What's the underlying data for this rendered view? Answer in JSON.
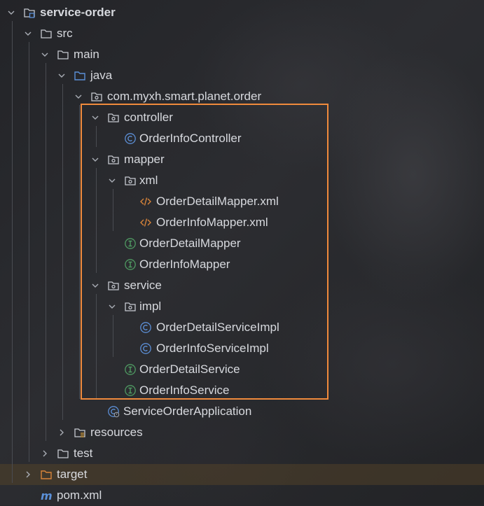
{
  "colors": {
    "background": "#26272b",
    "text": "#d7d9de",
    "highlight_border": "#f08a3c",
    "class_icon": "#5c8fd6",
    "interface_icon": "#4f9a62",
    "xml_icon": "#d8843a",
    "folder_source": "#5b90d8",
    "selected_row": "#5c4828"
  },
  "tree": {
    "root": {
      "label": "service-order",
      "icon": "module-folder-icon"
    },
    "src": {
      "label": "src",
      "icon": "folder-icon"
    },
    "main": {
      "label": "main",
      "icon": "folder-icon"
    },
    "java": {
      "label": "java",
      "icon": "source-folder-icon"
    },
    "package": {
      "label": "com.myxh.smart.planet.order",
      "icon": "package-icon"
    },
    "controller": {
      "label": "controller",
      "icon": "package-icon"
    },
    "order_info_controller": {
      "label": "OrderInfoController",
      "icon": "class-icon"
    },
    "mapper": {
      "label": "mapper",
      "icon": "package-icon"
    },
    "xml": {
      "label": "xml",
      "icon": "package-icon"
    },
    "order_detail_mapper_xml": {
      "label": "OrderDetailMapper.xml",
      "icon": "xml-icon"
    },
    "order_info_mapper_xml": {
      "label": "OrderInfoMapper.xml",
      "icon": "xml-icon"
    },
    "order_detail_mapper": {
      "label": "OrderDetailMapper",
      "icon": "interface-icon"
    },
    "order_info_mapper": {
      "label": "OrderInfoMapper",
      "icon": "interface-icon"
    },
    "service": {
      "label": "service",
      "icon": "package-icon"
    },
    "impl": {
      "label": "impl",
      "icon": "package-icon"
    },
    "order_detail_service_impl": {
      "label": "OrderDetailServiceImpl",
      "icon": "class-icon"
    },
    "order_info_service_impl": {
      "label": "OrderInfoServiceImpl",
      "icon": "class-icon"
    },
    "order_detail_service": {
      "label": "OrderDetailService",
      "icon": "interface-icon"
    },
    "order_info_service": {
      "label": "OrderInfoService",
      "icon": "interface-icon"
    },
    "service_order_application": {
      "label": "ServiceOrderApplication",
      "icon": "spring-boot-class-icon"
    },
    "resources": {
      "label": "resources",
      "icon": "resources-folder-icon"
    },
    "test": {
      "label": "test",
      "icon": "folder-icon"
    },
    "target": {
      "label": "target",
      "icon": "excluded-folder-icon"
    },
    "pom": {
      "label": "pom.xml",
      "icon": "maven-icon"
    }
  }
}
